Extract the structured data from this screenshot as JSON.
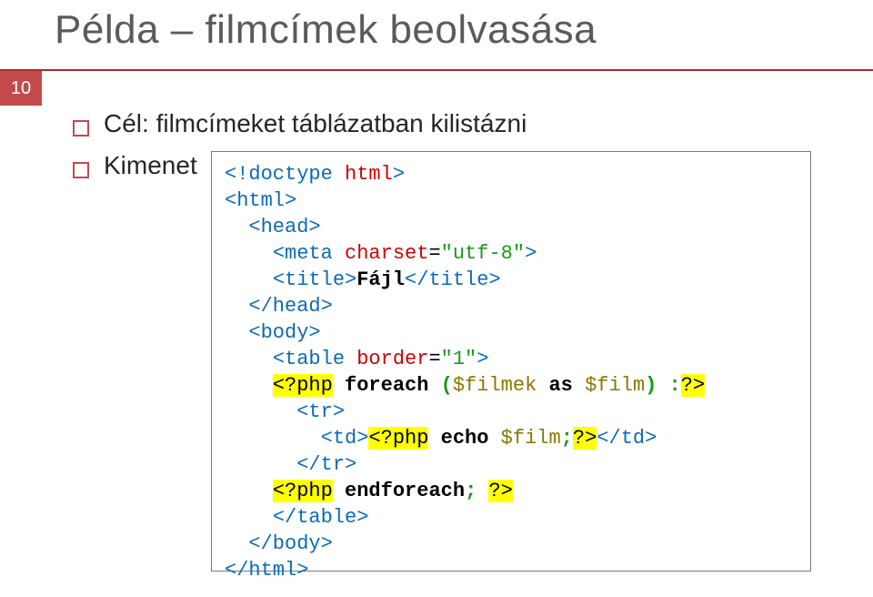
{
  "slide": {
    "title": "Példa – filmcímek beolvasása",
    "number": "10"
  },
  "bullets": {
    "b1": "Cél: filmcímeket táblázatban kilistázni",
    "b2": "Kimenet"
  },
  "code": {
    "l01_open": "<!",
    "l01_kw": "doctype",
    "l01_sp": " ",
    "l01_attr": "html",
    "l01_close": ">",
    "l02": "<html>",
    "l03": "<head>",
    "l04_open": "<meta ",
    "l04_attr": "charset",
    "l04_eq": "=",
    "l04_val": "\"utf-8\"",
    "l04_close": ">",
    "l05_open": "<title>",
    "l05_text": "Fájl",
    "l05_close": "</title>",
    "l06": "</head>",
    "l07": "<body>",
    "l08_open": "<table ",
    "l08_attr": "border",
    "l08_eq": "=",
    "l08_val": "\"1\"",
    "l08_close": ">",
    "l09_php_open": "<?php",
    "l09_sp": " ",
    "l09_foreach": "foreach",
    "l09_sp2": " ",
    "l09_paren_open": "(",
    "l09_var1": "$filmek",
    "l09_sp3": " ",
    "l09_as": "as",
    "l09_sp4": " ",
    "l09_var2": "$film",
    "l09_paren_close": ")",
    "l09_sp5": " ",
    "l09_colon": ":",
    "l09_php_close": "?>",
    "l10": "<tr>",
    "l11_td_open": "<td>",
    "l11_php_open": "<?php",
    "l11_sp": " ",
    "l11_echo": "echo",
    "l11_sp2": " ",
    "l11_var": "$film",
    "l11_semi": ";",
    "l11_php_close": "?>",
    "l11_td_close": "</td>",
    "l12": "</tr>",
    "l13_php_open": "<?php",
    "l13_sp": " ",
    "l13_endforeach": "endforeach",
    "l13_semi": ";",
    "l13_sp2": " ",
    "l13_php_close": "?>",
    "l14": "</table>",
    "l15": "</body>",
    "l16": "</html>"
  }
}
